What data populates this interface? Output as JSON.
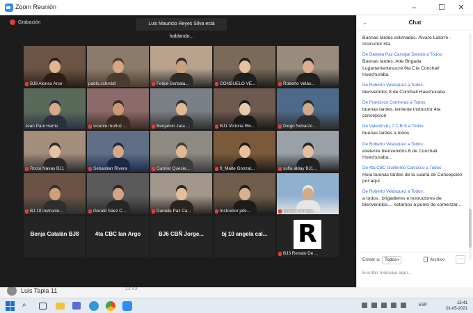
{
  "background": {
    "behind_name": "Luis Tapia 11",
    "behind_number": "12:43"
  },
  "window": {
    "title": "Zoom Reunión",
    "minimize": "–",
    "maximize": "☐",
    "close": "✕"
  },
  "meeting": {
    "recording_label": "Grabación",
    "speaking": "Luis Mauricio Reyes Silva está hablando...",
    "tiles": [
      {
        "name": "BJ8 Alonso Arce",
        "muted": true
      },
      {
        "name": "pablo.schmidt",
        "muted": false
      },
      {
        "name": "Felipe Borbala...",
        "muted": true
      },
      {
        "name": "CONSUELO VE...",
        "muted": true
      },
      {
        "name": "Roberto Velás...",
        "muted": true
      },
      {
        "name": "Jean Paul Harris",
        "muted": false
      },
      {
        "name": "vicente muñoz ...",
        "muted": true
      },
      {
        "name": "Benjamin Jara ...",
        "muted": true
      },
      {
        "name": "BJ1 Victoria Riv...",
        "muted": true
      },
      {
        "name": "Diego Sobarzo...",
        "muted": true
      },
      {
        "name": "Rocio Navas BJ1",
        "muted": true
      },
      {
        "name": "Sebastian Rivera",
        "muted": true
      },
      {
        "name": "Gabriel Quesie...",
        "muted": true
      },
      {
        "name": "9_Maite Gonzal...",
        "muted": true
      },
      {
        "name": "sofia alday BJ1...",
        "muted": true
      },
      {
        "name": "BJ 10 instructo...",
        "muted": true
      },
      {
        "name": "Gerald Sáez C...",
        "muted": true
      },
      {
        "name": "Daniela Paz Ca...",
        "muted": true
      },
      {
        "name": "Instructor jefe...",
        "muted": true
      },
      {
        "name": "ignacio ferrada...",
        "muted": true
      },
      {
        "name": "Benja Catalán BJ8",
        "muted": false,
        "text_only": true
      },
      {
        "name": "4ta CBC Ian Argo",
        "muted": false,
        "text_only": true
      },
      {
        "name": "BJ6 CBÑ Jorge...",
        "muted": false,
        "text_only": true
      },
      {
        "name": "bj 10 angela cal...",
        "muted": false,
        "text_only": true
      },
      {
        "name": "BJ3 Renato De ...",
        "muted": true,
        "logo": "R"
      }
    ]
  },
  "chat": {
    "title": "Chat",
    "messages": [
      {
        "from": "",
        "text": "Buenas tardes estimados. Álvaro Latorre - Instructor 4ta."
      },
      {
        "from": "De Daniela Paz Carvajal Devoto a Todos:",
        "text": "Buenas tardes. Atte Brigada Lugartenientesucre 6ta Cía Conchalí Huechuraba."
      },
      {
        "from": "De Roberto Velásquez a Todos:",
        "text": "bienvenidos 8 de Conchali Huechuraba"
      },
      {
        "from": "De Francisco Contreras a Todos:",
        "text": "buenas tardes, teniente instructor 4ta concepcion"
      },
      {
        "from": "De Valentin b.j 7 C.B.S a Todos:",
        "text": "buenas tardes a todos"
      },
      {
        "from": "De Roberto Velásquez a Todos:",
        "text": "exelente bienvenidos 6 de Conchali Huechuraba..."
      },
      {
        "from": "De 4ta CBC Guillermo Carrasco a Todos:",
        "text": "Hola buenas tardes de la cuarta de Concepción por aquí"
      },
      {
        "from": "De Roberto Velásquez a Todos:",
        "text": "a todos.. brigadieres e instructores de bienvenidos.... estamos a punto de comenzar..."
      }
    ],
    "send_to_label": "Enviar a:",
    "send_to_value": "Todos",
    "file_label": "Archivo",
    "more_label": "···",
    "composer_placeholder": "Escribir mensaje aquí..."
  },
  "taskbar": {
    "language": "ESP",
    "time": "15:41",
    "date": "01-05-2021"
  }
}
